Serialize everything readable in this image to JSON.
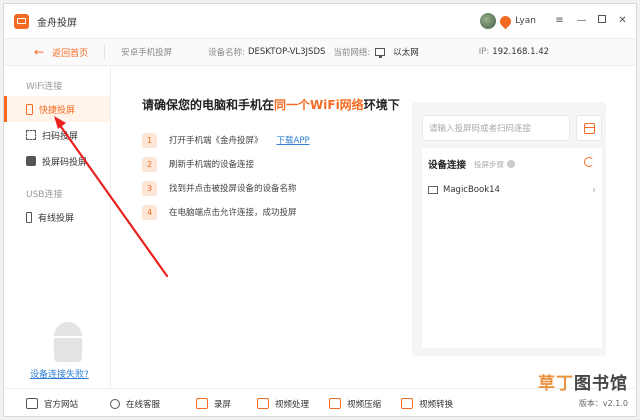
{
  "app": {
    "title": "金舟投屏",
    "username": "Lyan"
  },
  "colors": {
    "accent": "#f36b22",
    "link": "#2f7fd4"
  },
  "topbar": {
    "back_label": "返回首页",
    "section": "安卓手机投屏",
    "device_name_label": "设备名称:",
    "device_name": "DESKTOP-VL3JSDS",
    "network_label": "当前网络:",
    "network": "以太网",
    "ip_label": "IP:",
    "ip": "192.168.1.42"
  },
  "sidebar": {
    "wifi_group": "WiFi连接",
    "items": [
      {
        "label": "快捷投屏",
        "icon": "phone-icon"
      },
      {
        "label": "扫码投屏",
        "icon": "scan-icon"
      },
      {
        "label": "投屏码投屏",
        "icon": "code-icon"
      }
    ],
    "usb_group": "USB连接",
    "usb_item": {
      "label": "有线投屏",
      "icon": "usb-icon"
    },
    "fail_link": "设备连接失败?"
  },
  "main": {
    "headline_pre": "请确保您的电脑和手机在",
    "headline_hl": "同一个WiFi网络",
    "headline_post": "环境下",
    "steps": [
      {
        "num": "1",
        "text": "打开手机端《金舟投屏》",
        "link": "下载APP"
      },
      {
        "num": "2",
        "text": "刷新手机端的设备连接"
      },
      {
        "num": "3",
        "text": "找到并点击被投屏设备的设备名称"
      },
      {
        "num": "4",
        "text": "在电脑端点击允许连接，成功投屏"
      }
    ]
  },
  "panel": {
    "search_placeholder": "请输入投屏码或者扫码连接",
    "list_title": "设备连接",
    "list_sub": "投屏步骤",
    "device": "MagicBook14"
  },
  "footer": {
    "items": [
      "官方网站",
      "在线客服",
      "录屏",
      "视频处理",
      "视频压缩",
      "视频转换"
    ],
    "version": "版本：v2.1.0"
  },
  "watermark": {
    "a": "草丁",
    "b": "图书馆"
  }
}
